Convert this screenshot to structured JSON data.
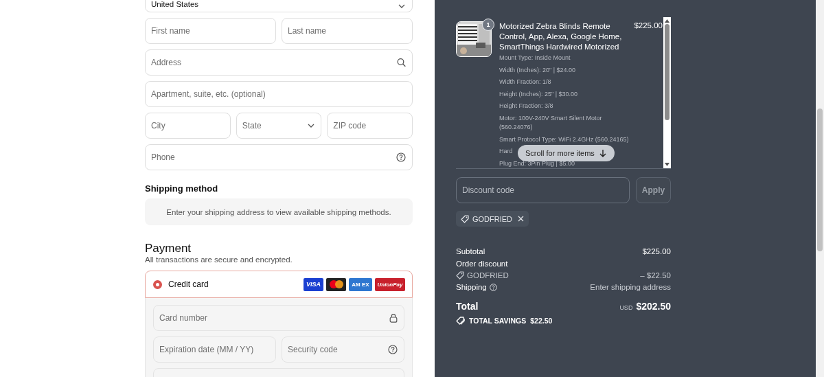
{
  "checkout_form": {
    "country_select": {
      "value": "United States"
    },
    "field_rows": [
      [
        {
          "placeholder": "First name",
          "kind": "text"
        },
        {
          "placeholder": "Last name",
          "kind": "text"
        }
      ],
      [
        {
          "placeholder": "Address",
          "kind": "search"
        }
      ],
      [
        {
          "placeholder": "Apartment, suite, etc. (optional)",
          "kind": "text"
        }
      ],
      [
        {
          "placeholder": "City",
          "kind": "text"
        },
        {
          "placeholder": "State",
          "kind": "select"
        },
        {
          "placeholder": "ZIP code",
          "kind": "text"
        }
      ],
      [
        {
          "placeholder": "Phone",
          "kind": "help"
        }
      ]
    ],
    "shipping_method": {
      "heading": "Shipping method",
      "notice": "Enter your shipping address to view available shipping methods."
    },
    "payment": {
      "heading": "Payment",
      "subtitle": "All transactions are secure and encrypted.",
      "methods": [
        {
          "label": "Credit card",
          "selected": true,
          "card_brands": [
            {
              "kind": "visa",
              "label": "VISA"
            },
            {
              "kind": "mastercard"
            },
            {
              "kind": "amex",
              "label": "AM EX"
            },
            {
              "kind": "unionpay",
              "label": "UnionPay"
            }
          ],
          "field_rows": [
            [
              {
                "placeholder": "Card number",
                "kind": "lock"
              }
            ],
            [
              {
                "placeholder": "Expiration date (MM / YY)",
                "kind": "text"
              },
              {
                "placeholder": "Security code",
                "kind": "help"
              }
            ],
            [
              {
                "kind": "text"
              }
            ]
          ]
        }
      ]
    }
  },
  "order_summary": {
    "items": [
      {
        "quantity": "1",
        "title": "Motorized Zebra Blinds Remote Control, App, Alexa, Google Home, SmartThings Hardwired Motorized",
        "price": "$225.00",
        "options": [
          "Mount Type: Inside Mount",
          "Width (Inches): 20\" | $24.00",
          "Width Fraction: 1/8",
          "Height (Inches): 25\" | $30.00",
          "Height Fraction: 3/8",
          "Motor: 100V-240V Smart Silent Motor (560.24076)",
          "Smart Protocol Type: WiFi 2.4GHz (560.24165)",
          "Hard",
          "Plug End: 3Pin Plug | $5.00"
        ]
      }
    ],
    "scroll_hint": "Scroll for more items",
    "discount": {
      "placeholder": "Discount code",
      "button": "Apply",
      "disabled": true,
      "applied_codes": [
        "GODFRIED"
      ]
    },
    "lines": [
      {
        "kind": "plain",
        "label": "Subtotal",
        "value": "$225.00"
      },
      {
        "kind": "heading",
        "label": "Order discount"
      },
      {
        "kind": "code",
        "label": "GODFRIED",
        "value": "– $22.50"
      },
      {
        "kind": "help",
        "label": "Shipping",
        "value": "Enter shipping address"
      }
    ],
    "total": {
      "label": "Total",
      "currency": "USD",
      "value": "$202.50"
    },
    "savings": {
      "label": "TOTAL SAVINGS",
      "value": "$22.50"
    }
  }
}
